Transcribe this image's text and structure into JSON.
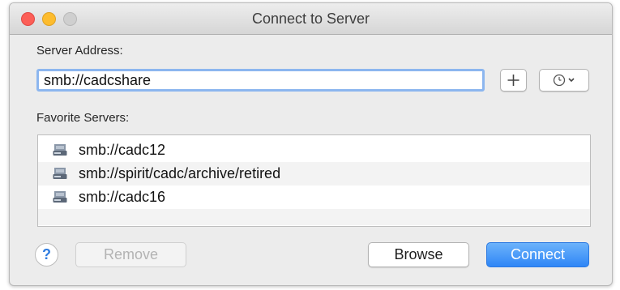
{
  "window": {
    "title": "Connect to Server"
  },
  "server_address": {
    "label": "Server Address:",
    "value": "smb://cadcshare"
  },
  "favorites": {
    "label": "Favorite Servers:",
    "items": [
      {
        "text": "smb://cadc12",
        "icon": "network-drive-icon"
      },
      {
        "text": "smb://spirit/cadc/archive/retired",
        "icon": "network-drive-icon"
      },
      {
        "text": "smb://cadc16",
        "icon": "network-drive-icon"
      }
    ]
  },
  "buttons": {
    "help": "?",
    "remove": "Remove",
    "browse": "Browse",
    "connect": "Connect"
  },
  "icons": {
    "add": "plus-icon",
    "recent": "clock-icon"
  },
  "colors": {
    "accent": "#2f86f6",
    "close": "#fc5f57",
    "minimize": "#fdbc2e",
    "focus_ring": "#8cb6ef"
  }
}
